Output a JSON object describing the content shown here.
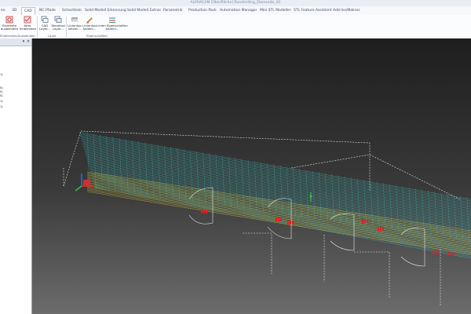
{
  "window": {
    "title": "ALPHACAM [Oberfläche] Rundmilling_Ebenseite_01"
  },
  "ribbon_tabs": [
    {
      "label": "en"
    },
    {
      "label": "3D"
    },
    {
      "label": "CAD"
    },
    {
      "label": "NC-Pfade"
    },
    {
      "label": "Schachtelo"
    },
    {
      "label": "Solid Modell Erkennung"
    },
    {
      "label": "Solid Modell Extras"
    },
    {
      "label": "Parametrik"
    },
    {
      "label": "Production Pack"
    },
    {
      "label": "Automation Manager"
    },
    {
      "label": "Mini STL Modeller"
    },
    {
      "label": "STL Feature Assistent"
    },
    {
      "label": "Add-Ins/Makros"
    }
  ],
  "ribbon": {
    "tools": [
      {
        "label1": "Elemente",
        "label2": "ausblenden"
      },
      {
        "label1": "Alles",
        "label2": "einblenden"
      },
      {
        "label1": "CAD",
        "label2": "Layer..."
      },
      {
        "label1": "Standard",
        "label2": "Layer..."
      },
      {
        "label1": "Linientyp",
        "label2": "setzen..."
      },
      {
        "label1": "Linientyp",
        "label2": "ändern..."
      },
      {
        "label1": "Linien Eigenschaften",
        "label2": "ändern..."
      }
    ],
    "groups": [
      {
        "label": "Einblenden/Ausblenden"
      },
      {
        "label": "Layer"
      },
      {
        "label": "Eigenschaften"
      }
    ]
  },
  "left_panel": {
    "close_glyph": "×",
    "pin_glyph": "▾",
    "tree": [
      {
        "text": "1)"
      },
      {
        "text": "0)"
      },
      {
        "text": "0)"
      },
      {
        "text": "0)"
      },
      {
        "text": "1)"
      },
      {
        "text": "1)"
      }
    ]
  },
  "colors": {
    "toolpath_cyan": "#3ee6e6",
    "toolpath_yellow": "#d8c23a",
    "wire_white": "#e8e8e8",
    "marker_red": "#e02020"
  }
}
